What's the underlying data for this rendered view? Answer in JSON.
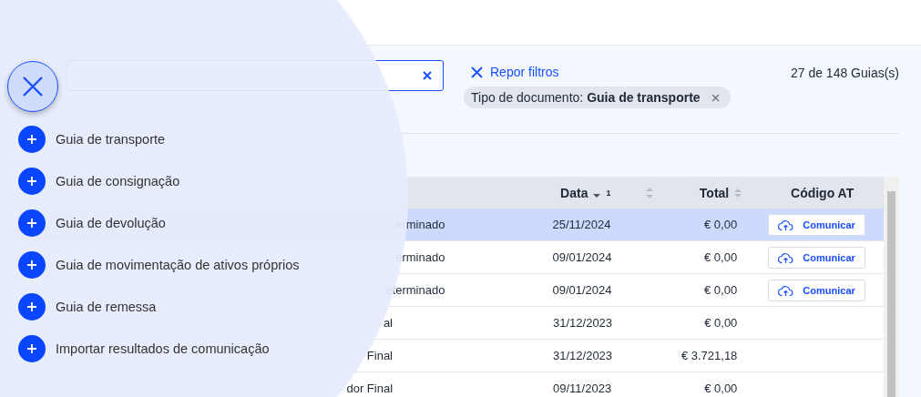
{
  "reset_filters": "Repor filtros",
  "count": "27 de 148 Guias(s)",
  "filter_chip": {
    "label": "Tipo de documento:",
    "value": "Guia de transporte"
  },
  "table": {
    "columns": [
      {
        "label": "Data",
        "sort_index": "1",
        "sorted": true
      },
      {
        "label": "Total",
        "sorted": false
      },
      {
        "label": "Código AT"
      }
    ],
    "rows": [
      {
        "selected": true,
        "name": "erminado",
        "date": "25/11/2024",
        "total": "€ 0,00",
        "action": "Comunicar"
      },
      {
        "selected": false,
        "name": "erminado",
        "date": "09/01/2024",
        "total": "€ 0,00",
        "action": "Comunicar"
      },
      {
        "selected": false,
        "name": "eterminado",
        "date": "09/01/2024",
        "total": "€ 0,00",
        "action": "Comunicar"
      },
      {
        "selected": false,
        "name": "al",
        "date": "31/12/2023",
        "total": "€ 0,00"
      },
      {
        "selected": false,
        "name": "Final",
        "date": "31/12/2023",
        "total": "€ 3.721,18"
      },
      {
        "selected": false,
        "name": "dor Final",
        "date": "09/11/2023",
        "total": "€ 0,00"
      }
    ]
  },
  "menu": {
    "open": true,
    "items": [
      "Guia de transporte",
      "Guia de consignação",
      "Guia de devolução",
      "Guia de movimentação de ativos próprios",
      "Guia de remessa",
      "Importar resultados de comunicação"
    ]
  }
}
